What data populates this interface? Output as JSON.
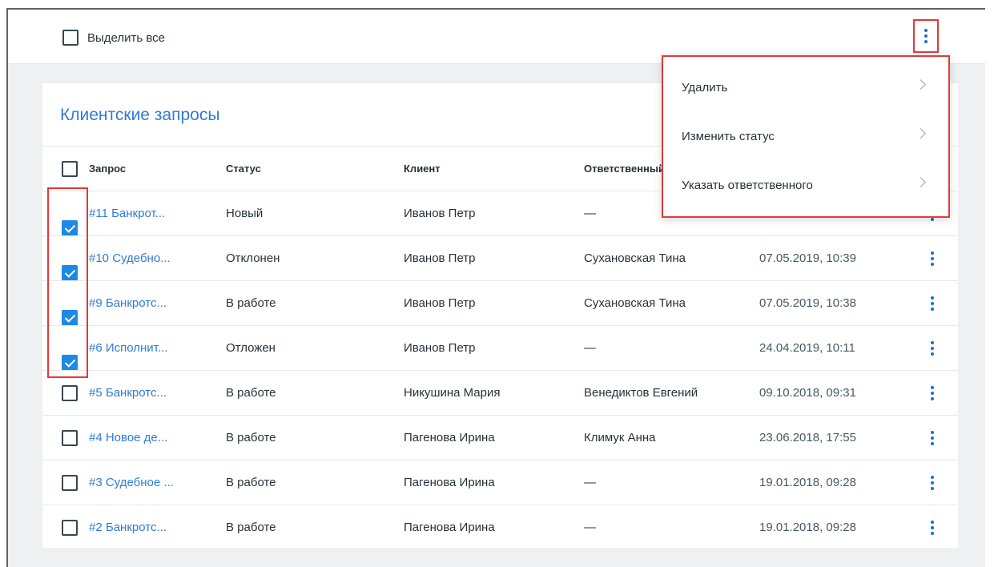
{
  "toolbar": {
    "select_all_label": "Выделить все"
  },
  "card": {
    "title": "Клиентские запросы"
  },
  "table": {
    "headers": {
      "request": "Запрос",
      "status": "Статус",
      "client": "Клиент",
      "responsible": "Ответственный"
    },
    "rows": [
      {
        "request": "#11 Банкрот...",
        "status": "Новый",
        "client": "Иванов Петр",
        "responsible": "—",
        "date": "",
        "checked": true
      },
      {
        "request": "#10 Судебно...",
        "status": "Отклонен",
        "client": "Иванов Петр",
        "responsible": "Сухановская Тина",
        "date": "07.05.2019, 10:39",
        "checked": true
      },
      {
        "request": "#9 Банкротс...",
        "status": "В работе",
        "client": "Иванов Петр",
        "responsible": "Сухановская Тина",
        "date": "07.05.2019, 10:38",
        "checked": true
      },
      {
        "request": "#6 Исполнит...",
        "status": "Отложен",
        "client": "Иванов Петр",
        "responsible": "—",
        "date": "24.04.2019, 10:11",
        "checked": true
      },
      {
        "request": "#5 Банкротс...",
        "status": "В работе",
        "client": "Никушина Мария",
        "responsible": "Венедиктов Евгений",
        "date": "09.10.2018, 09:31",
        "checked": false
      },
      {
        "request": "#4 Новое де...",
        "status": "В работе",
        "client": "Пагенова Ирина",
        "responsible": "Климук Анна",
        "date": "23.06.2018, 17:55",
        "checked": false
      },
      {
        "request": "#3 Судебное ...",
        "status": "В работе",
        "client": "Пагенова Ирина",
        "responsible": "—",
        "date": "19.01.2018, 09:28",
        "checked": false
      },
      {
        "request": "#2 Банкротс...",
        "status": "В работе",
        "client": "Пагенова Ирина",
        "responsible": "—",
        "date": "19.01.2018, 09:28",
        "checked": false
      }
    ]
  },
  "menu": {
    "items": [
      {
        "label": "Удалить"
      },
      {
        "label": "Изменить статус"
      },
      {
        "label": "Указать ответственного"
      }
    ]
  },
  "colors": {
    "accent": "#2f7bd6",
    "checkbox": "#1e88e5",
    "highlight": "#e53935",
    "background": "#eef0f2"
  },
  "icons": {
    "row_action": "more-vert-icon",
    "menu_chevron": "chevron-right-icon",
    "checkbox": "checkbox-icon"
  }
}
